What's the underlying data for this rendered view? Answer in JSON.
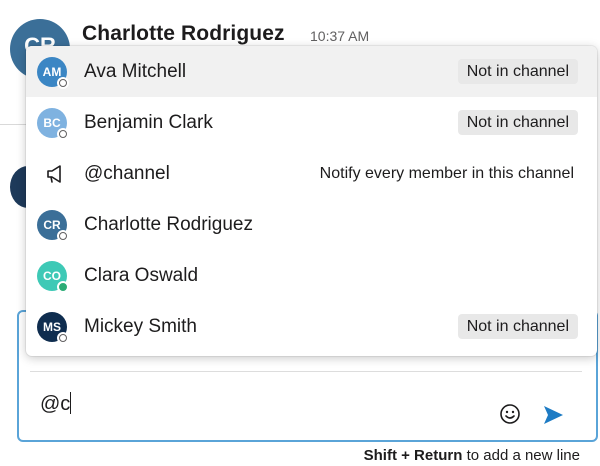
{
  "message": {
    "author": "Charlotte Rodriguez",
    "time": "10:37 AM",
    "avatar_initials": "CR"
  },
  "mention_dropdown": {
    "items": [
      {
        "name": "Ava Mitchell",
        "initials": "AM",
        "avatar_color": "#3b86c4",
        "presence": "away",
        "badge": "Not in channel"
      },
      {
        "name": "Benjamin Clark",
        "initials": "BC",
        "avatar_color": "#7fb2e0",
        "presence": "away",
        "badge": "Not in channel"
      },
      {
        "name": "@channel",
        "icon": "megaphone-icon",
        "description": "Notify every member in this channel"
      },
      {
        "name": "Charlotte Rodriguez",
        "initials": "CR",
        "avatar_color": "#3b6f98",
        "presence": "away"
      },
      {
        "name": "Clara Oswald",
        "initials": "CO",
        "avatar_color": "#3ec9b6",
        "presence": "online"
      },
      {
        "name": "Mickey Smith",
        "initials": "MS",
        "avatar_color": "#0f2d4f",
        "presence": "away",
        "badge": "Not in channel"
      }
    ]
  },
  "composer": {
    "value": "@c",
    "emoji_icon": "smiley-icon",
    "send_icon": "send-icon",
    "send_color": "#1d7bc4"
  },
  "hint": {
    "shortcut": "Shift + Return",
    "text": "to add a new line"
  }
}
